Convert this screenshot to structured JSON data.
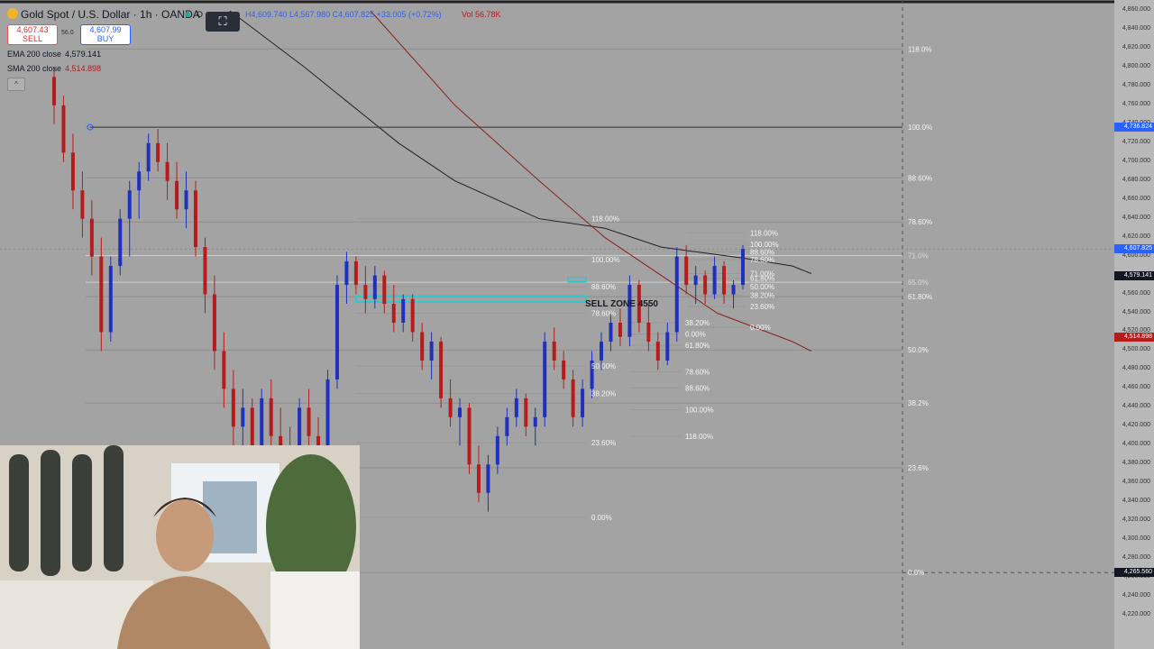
{
  "header": {
    "symbol": "Gold Spot / U.S. Dollar · 1h · OANDA",
    "open_label": "O",
    "ohlc_text": "H4,609.740 L4,567.980 C4,607.825 +33.005 (+0.72%)",
    "volume_text": "Vol 56.78K",
    "drawing_icon": "⛶"
  },
  "trade": {
    "sell_price": "4,607.43",
    "sell_label": "SELL",
    "spread": "56.0",
    "buy_price": "4,607.99",
    "buy_label": "BUY"
  },
  "indicators": {
    "ema_label": "EMA 200 close",
    "ema_value": "4,579.141",
    "sma_label": "SMA 200 close",
    "sma_value": "4,514.898",
    "collapse_icon": "^"
  },
  "colors": {
    "background": "#a3a3a3",
    "up_candle": "#1f2fbf",
    "down_candle": "#b71c1c",
    "ema": "#222222",
    "sma": "#8b2020",
    "zone": "#33c5cc"
  },
  "chart_data": {
    "type": "candlestick",
    "title": "Gold Spot / U.S. Dollar · 1h · OANDA",
    "ylim": [
      4200,
      4860
    ],
    "price_ticks": [
      "4,860.000",
      "4,840.000",
      "4,820.000",
      "4,800.000",
      "4,780.000",
      "4,760.000",
      "4,740.000",
      "4,720.000",
      "4,700.000",
      "4,680.000",
      "4,660.000",
      "4,640.000",
      "4,620.000",
      "4,600.000",
      "4,580.000",
      "4,560.000",
      "4,540.000",
      "4,520.000",
      "4,500.000",
      "4,480.000",
      "4,460.000",
      "4,440.000",
      "4,420.000",
      "4,400.000",
      "4,380.000",
      "4,360.000",
      "4,340.000",
      "4,320.000",
      "4,300.000",
      "4,280.000",
      "4,260.000",
      "4,240.000",
      "4,220.000"
    ],
    "price_values": [
      4860,
      4840,
      4820,
      4800,
      4780,
      4760,
      4740,
      4720,
      4700,
      4680,
      4660,
      4640,
      4620,
      4600,
      4580,
      4560,
      4540,
      4520,
      4500,
      4480,
      4460,
      4440,
      4420,
      4400,
      4380,
      4360,
      4340,
      4320,
      4300,
      4280,
      4260,
      4240,
      4220
    ],
    "badges": [
      {
        "text": "4,736.824",
        "value": 4736.824,
        "color": "#2962ff"
      },
      {
        "text": "4,607.825",
        "value": 4607.825,
        "color": "#2962ff"
      },
      {
        "text": "4,579.141",
        "value": 4579.141,
        "color": "#131722"
      },
      {
        "text": "4,514.898",
        "value": 4514.898,
        "color": "#b71c1c"
      },
      {
        "text": "4,265.560",
        "value": 4265.56,
        "color": "#131722"
      }
    ],
    "fib_main": {
      "high": 4736.824,
      "low": 4265.56,
      "levels": [
        {
          "label": "118.0%",
          "value": 4819.7
        },
        {
          "label": "100.0%",
          "value": 4736.8
        },
        {
          "label": "88.60%",
          "value": 4683.3
        },
        {
          "label": "78.60%",
          "value": 4636.6
        },
        {
          "label": "71.0%",
          "value": 4601.0
        },
        {
          "label": "65.0%",
          "value": 4572.8
        },
        {
          "label": "61.80%",
          "value": 4557.5
        },
        {
          "label": "50.0%",
          "value": 4501.2
        },
        {
          "label": "38.2%",
          "value": 4444.9
        },
        {
          "label": "23.6%",
          "value": 4376.5
        },
        {
          "label": "0.0%",
          "value": 4265.6
        }
      ]
    },
    "fib_mid_labels": [
      "118.00%",
      "100.00%",
      "88.60%",
      "78.60%",
      "50.00%",
      "38.20%",
      "23.60%",
      "0.00%"
    ],
    "fib_mid_values": [
      4640,
      4597,
      4568,
      4540,
      4484,
      4455,
      4403,
      4324
    ],
    "fib_right_labels": [
      "118.00%",
      "100.00%",
      "88.60%",
      "78.60%",
      "71.00%",
      "61.80%",
      "50.00%",
      "38.20%",
      "23.60%",
      "0.00%"
    ],
    "fib_right_values": [
      4625,
      4613,
      4605,
      4597,
      4582,
      4577,
      4568,
      4559,
      4547,
      4525
    ],
    "fib_inner_labels": [
      "38.20%",
      "0.00%",
      "61.80%",
      "78.60%",
      "88.60%",
      "100.00%",
      "118.00%"
    ],
    "fib_inner_values": [
      4530,
      4518,
      4506,
      4478,
      4461,
      4438,
      4410
    ],
    "sell_zone": {
      "label": "SELL ZONE 4550",
      "top": 4558,
      "bottom": 4552
    },
    "candles": [
      {
        "o": 4790,
        "h": 4800,
        "l": 4740,
        "c": 4760
      },
      {
        "o": 4760,
        "h": 4770,
        "l": 4700,
        "c": 4710
      },
      {
        "o": 4710,
        "h": 4730,
        "l": 4650,
        "c": 4670
      },
      {
        "o": 4670,
        "h": 4690,
        "l": 4620,
        "c": 4640
      },
      {
        "o": 4640,
        "h": 4660,
        "l": 4580,
        "c": 4600
      },
      {
        "o": 4600,
        "h": 4620,
        "l": 4500,
        "c": 4520
      },
      {
        "o": 4520,
        "h": 4600,
        "l": 4510,
        "c": 4590
      },
      {
        "o": 4590,
        "h": 4650,
        "l": 4580,
        "c": 4640
      },
      {
        "o": 4640,
        "h": 4680,
        "l": 4600,
        "c": 4670
      },
      {
        "o": 4670,
        "h": 4700,
        "l": 4640,
        "c": 4690
      },
      {
        "o": 4690,
        "h": 4730,
        "l": 4680,
        "c": 4720
      },
      {
        "o": 4720,
        "h": 4735,
        "l": 4690,
        "c": 4700
      },
      {
        "o": 4700,
        "h": 4720,
        "l": 4660,
        "c": 4680
      },
      {
        "o": 4680,
        "h": 4700,
        "l": 4640,
        "c": 4650
      },
      {
        "o": 4650,
        "h": 4690,
        "l": 4630,
        "c": 4670
      },
      {
        "o": 4670,
        "h": 4680,
        "l": 4600,
        "c": 4610
      },
      {
        "o": 4610,
        "h": 4620,
        "l": 4540,
        "c": 4560
      },
      {
        "o": 4560,
        "h": 4580,
        "l": 4480,
        "c": 4500
      },
      {
        "o": 4500,
        "h": 4520,
        "l": 4440,
        "c": 4460
      },
      {
        "o": 4460,
        "h": 4480,
        "l": 4400,
        "c": 4420
      },
      {
        "o": 4420,
        "h": 4460,
        "l": 4380,
        "c": 4440
      },
      {
        "o": 4440,
        "h": 4450,
        "l": 4380,
        "c": 4400
      },
      {
        "o": 4400,
        "h": 4460,
        "l": 4390,
        "c": 4450
      },
      {
        "o": 4450,
        "h": 4470,
        "l": 4390,
        "c": 4410
      },
      {
        "o": 4410,
        "h": 4440,
        "l": 4380,
        "c": 4400
      },
      {
        "o": 4400,
        "h": 4420,
        "l": 4370,
        "c": 4390
      },
      {
        "o": 4390,
        "h": 4450,
        "l": 4380,
        "c": 4440
      },
      {
        "o": 4440,
        "h": 4460,
        "l": 4400,
        "c": 4410
      },
      {
        "o": 4410,
        "h": 4430,
        "l": 4370,
        "c": 4385
      },
      {
        "o": 4385,
        "h": 4480,
        "l": 4380,
        "c": 4470
      },
      {
        "o": 4470,
        "h": 4580,
        "l": 4460,
        "c": 4570
      },
      {
        "o": 4570,
        "h": 4605,
        "l": 4550,
        "c": 4595
      },
      {
        "o": 4595,
        "h": 4600,
        "l": 4560,
        "c": 4570
      },
      {
        "o": 4570,
        "h": 4590,
        "l": 4540,
        "c": 4555
      },
      {
        "o": 4555,
        "h": 4590,
        "l": 4545,
        "c": 4580
      },
      {
        "o": 4580,
        "h": 4585,
        "l": 4540,
        "c": 4550
      },
      {
        "o": 4550,
        "h": 4570,
        "l": 4520,
        "c": 4530
      },
      {
        "o": 4530,
        "h": 4560,
        "l": 4520,
        "c": 4555
      },
      {
        "o": 4555,
        "h": 4560,
        "l": 4510,
        "c": 4520
      },
      {
        "o": 4520,
        "h": 4530,
        "l": 4480,
        "c": 4490
      },
      {
        "o": 4490,
        "h": 4520,
        "l": 4470,
        "c": 4510
      },
      {
        "o": 4510,
        "h": 4515,
        "l": 4440,
        "c": 4450
      },
      {
        "o": 4450,
        "h": 4470,
        "l": 4420,
        "c": 4430
      },
      {
        "o": 4430,
        "h": 4450,
        "l": 4400,
        "c": 4440
      },
      {
        "o": 4440,
        "h": 4445,
        "l": 4370,
        "c": 4380
      },
      {
        "o": 4380,
        "h": 4400,
        "l": 4340,
        "c": 4350
      },
      {
        "o": 4350,
        "h": 4390,
        "l": 4330,
        "c": 4380
      },
      {
        "o": 4380,
        "h": 4420,
        "l": 4370,
        "c": 4410
      },
      {
        "o": 4410,
        "h": 4440,
        "l": 4400,
        "c": 4430
      },
      {
        "o": 4430,
        "h": 4460,
        "l": 4420,
        "c": 4450
      },
      {
        "o": 4450,
        "h": 4455,
        "l": 4410,
        "c": 4420
      },
      {
        "o": 4420,
        "h": 4440,
        "l": 4400,
        "c": 4430
      },
      {
        "o": 4430,
        "h": 4520,
        "l": 4420,
        "c": 4510
      },
      {
        "o": 4510,
        "h": 4525,
        "l": 4480,
        "c": 4490
      },
      {
        "o": 4490,
        "h": 4500,
        "l": 4460,
        "c": 4470
      },
      {
        "o": 4470,
        "h": 4480,
        "l": 4420,
        "c": 4430
      },
      {
        "o": 4430,
        "h": 4470,
        "l": 4420,
        "c": 4460
      },
      {
        "o": 4460,
        "h": 4500,
        "l": 4450,
        "c": 4490
      },
      {
        "o": 4490,
        "h": 4520,
        "l": 4480,
        "c": 4510
      },
      {
        "o": 4510,
        "h": 4540,
        "l": 4500,
        "c": 4530
      },
      {
        "o": 4530,
        "h": 4545,
        "l": 4505,
        "c": 4515
      },
      {
        "o": 4515,
        "h": 4580,
        "l": 4505,
        "c": 4570
      },
      {
        "o": 4570,
        "h": 4575,
        "l": 4520,
        "c": 4530
      },
      {
        "o": 4530,
        "h": 4550,
        "l": 4500,
        "c": 4510
      },
      {
        "o": 4510,
        "h": 4520,
        "l": 4480,
        "c": 4490
      },
      {
        "o": 4490,
        "h": 4530,
        "l": 4485,
        "c": 4520
      },
      {
        "o": 4520,
        "h": 4610,
        "l": 4510,
        "c": 4600
      },
      {
        "o": 4600,
        "h": 4612,
        "l": 4560,
        "c": 4570
      },
      {
        "o": 4570,
        "h": 4590,
        "l": 4550,
        "c": 4580
      },
      {
        "o": 4580,
        "h": 4585,
        "l": 4550,
        "c": 4560
      },
      {
        "o": 4560,
        "h": 4600,
        "l": 4555,
        "c": 4590
      },
      {
        "o": 4590,
        "h": 4595,
        "l": 4550,
        "c": 4560
      },
      {
        "o": 4560,
        "h": 4575,
        "l": 4545,
        "c": 4570
      },
      {
        "o": 4570,
        "h": 4612,
        "l": 4565,
        "c": 4608
      }
    ],
    "ema_path": [
      [
        4860,
        0
      ],
      [
        4800,
        0.08
      ],
      [
        4720,
        0.18
      ],
      [
        4680,
        0.24
      ],
      [
        4640,
        0.33
      ],
      [
        4630,
        0.4
      ],
      [
        4610,
        0.46
      ],
      [
        4598,
        0.55
      ],
      [
        4590,
        0.6
      ],
      [
        4582,
        0.62
      ]
    ],
    "sma_path": [
      [
        4860,
        0.15
      ],
      [
        4760,
        0.24
      ],
      [
        4680,
        0.33
      ],
      [
        4620,
        0.4
      ],
      [
        4580,
        0.46
      ],
      [
        4540,
        0.52
      ],
      [
        4510,
        0.6
      ],
      [
        4500,
        0.62
      ]
    ]
  }
}
